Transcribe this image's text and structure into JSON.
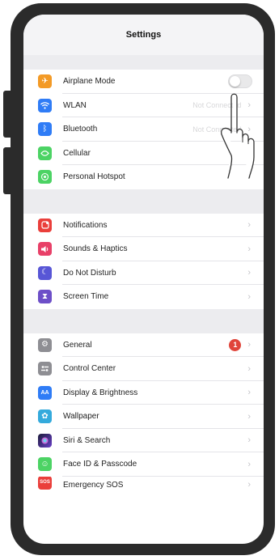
{
  "nav": {
    "title": "Settings"
  },
  "colors": {
    "frame": "#2b2b2b",
    "orange": "#f39a26",
    "blue": "#2f7cf6",
    "green": "#4cd364",
    "red": "#ea3f3b",
    "pink": "#e84068",
    "indigo": "#5856d6",
    "purple": "#6d4fc8",
    "gray": "#8e8e93",
    "light_blue": "#34aadc",
    "badge": "#e0443a"
  },
  "group1": [
    {
      "label": "Airplane Mode",
      "icon": "airplane-icon",
      "control": "toggle",
      "toggle_on": false
    },
    {
      "label": "WLAN",
      "icon": "wifi-icon",
      "value": "Not Connected"
    },
    {
      "label": "Bluetooth",
      "icon": "bluetooth-icon",
      "value": "Not Connected"
    },
    {
      "label": "Cellular",
      "icon": "cellular-icon"
    },
    {
      "label": "Personal Hotspot",
      "icon": "hotspot-icon"
    }
  ],
  "group2": [
    {
      "label": "Notifications",
      "icon": "notifications-icon"
    },
    {
      "label": "Sounds & Haptics",
      "icon": "sound-icon"
    },
    {
      "label": "Do Not Disturb",
      "icon": "moon-icon"
    },
    {
      "label": "Screen Time",
      "icon": "hourglass-icon"
    }
  ],
  "group3": [
    {
      "label": "General",
      "icon": "gear-icon",
      "badge": "1"
    },
    {
      "label": "Control Center",
      "icon": "control-center-icon"
    },
    {
      "label": "Display & Brightness",
      "icon": "display-icon"
    },
    {
      "label": "Wallpaper",
      "icon": "wallpaper-icon"
    },
    {
      "label": "Siri & Search",
      "icon": "siri-icon"
    },
    {
      "label": "Face ID & Passcode",
      "icon": "face-id-icon"
    },
    {
      "label": "Emergency SOS",
      "icon": "sos-icon"
    }
  ],
  "chevron": "›"
}
